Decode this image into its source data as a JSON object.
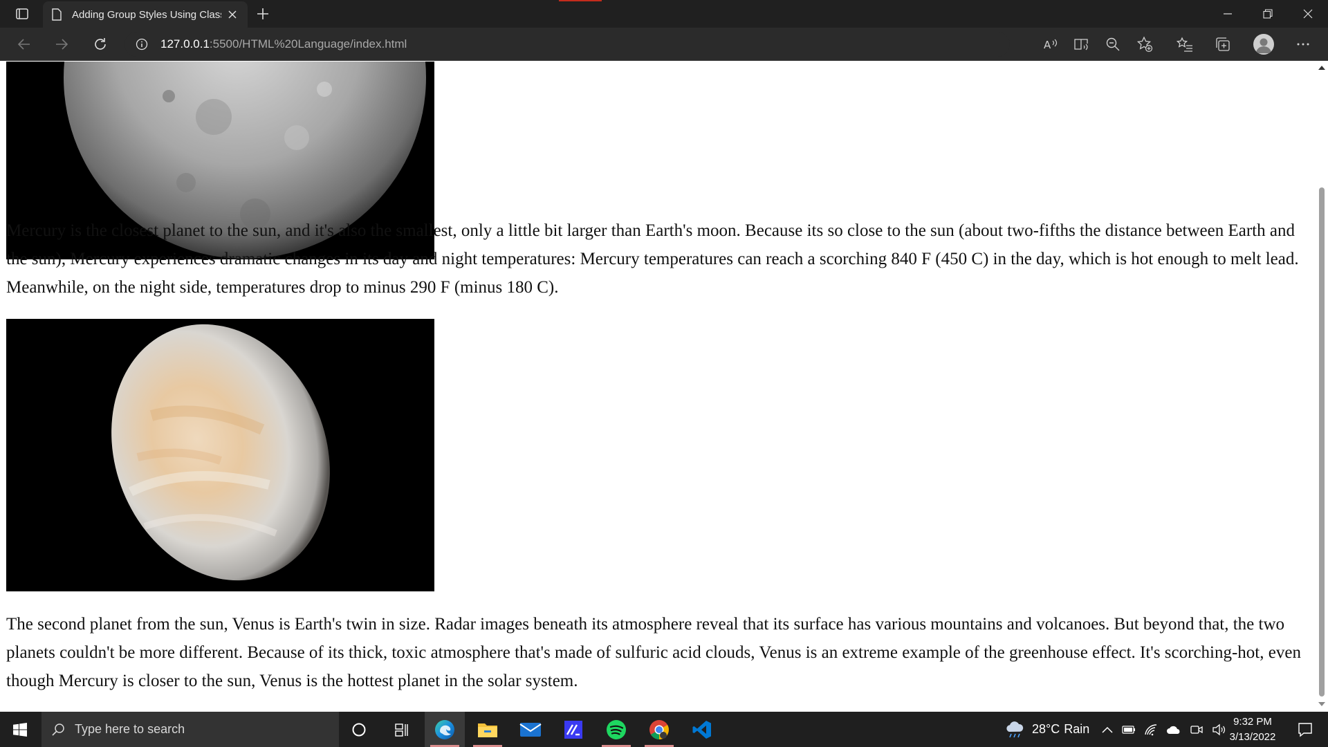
{
  "browser": {
    "tab": {
      "title": "Adding Group Styles Using Class",
      "icon": "page-icon"
    },
    "url": {
      "host": "127.0.0.1",
      "path": ":5500/HTML%20Language/index.html"
    },
    "toolbar_icons": [
      "back-icon",
      "forward-icon",
      "refresh-icon",
      "site-info-icon",
      "read-aloud-icon",
      "immersive-reader-icon",
      "zoom-out-icon",
      "add-favorite-icon",
      "favorites-icon",
      "collections-icon",
      "profile-avatar",
      "more-icon"
    ],
    "window_controls": [
      "minimize-icon",
      "restore-icon",
      "close-icon"
    ]
  },
  "page": {
    "mercury": {
      "image": "mercury-planet-image",
      "paragraph": "Mercury is the closest planet to the sun, and it's also the smallest, only a little bit larger than Earth's moon. Because its so close to the sun (about two-fifths the distance between Earth and the sun), Mercury experiences dramatic changes in its day and night temperatures: Mercury temperatures can reach a scorching 840 F (450 C) in the day, which is hot enough to melt lead. Meanwhile, on the night side, temperatures drop to minus 290 F (minus 180 C)."
    },
    "venus": {
      "image": "venus-planet-image",
      "paragraph": "The second planet from the sun, Venus is Earth's twin in size. Radar images beneath its atmosphere reveal that its surface has various mountains and volcanoes. But beyond that, the two planets couldn't be more different. Because of its thick, toxic atmosphere that's made of sulfuric acid clouds, Venus is an extreme example of the greenhouse effect. It's scorching-hot, even though Mercury is closer to the sun, Venus is the hottest planet in the solar system."
    }
  },
  "taskbar": {
    "search_placeholder": "Type here to search",
    "apps": [
      "cortana-icon",
      "task-view-icon",
      "edge-icon",
      "file-explorer-icon",
      "mail-icon",
      "ide-icon",
      "spotify-icon",
      "chrome-icon",
      "vscode-icon"
    ],
    "weather": {
      "temp": "28°C",
      "condition": "Rain"
    },
    "clock": {
      "time": "9:32 PM",
      "date": "3/13/2022"
    }
  },
  "colors": {
    "chrome_dark": "#202020",
    "toolbar": "#2b2b2b",
    "taskbar": "#1f1f1f",
    "running_indicator": "#d98c8c",
    "vscode_blue": "#0078d4",
    "spotify_green": "#1ed760"
  }
}
